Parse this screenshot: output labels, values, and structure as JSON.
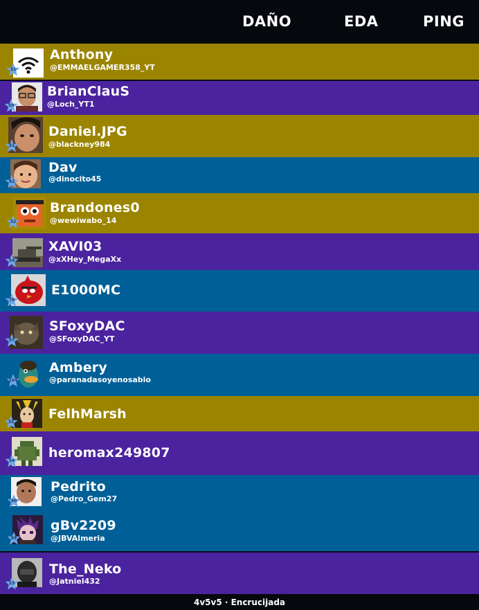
{
  "header": {
    "col_damage": "DAÑO",
    "col_eda": "EDA",
    "col_ping": "PING"
  },
  "players": [
    {
      "name": "Anthony",
      "handle": "@EMMAELGAMER358_YT",
      "level": "31",
      "team": "olive",
      "avatar": "wifi-logo"
    },
    {
      "name": "BrianClauS",
      "handle": "@Loch_YT1",
      "level": "59",
      "team": "purple",
      "avatar": "boy-glasses"
    },
    {
      "name": "Daniel.JPG",
      "handle": "@blackney984",
      "level": "51",
      "team": "olive",
      "avatar": "boy-photo"
    },
    {
      "name": "Dav",
      "handle": "@dinocito45",
      "level": "82",
      "team": "blue",
      "avatar": "child-photo"
    },
    {
      "name": "Brandones0",
      "handle": "@wewiwabo_14",
      "level": "32",
      "team": "olive",
      "avatar": "orange-block-character"
    },
    {
      "name": "XAVI03",
      "handle": "@xXHey_MegaXx",
      "level": "54",
      "team": "purple",
      "avatar": "tank"
    },
    {
      "name": "E1000MC",
      "handle": "",
      "level": "78",
      "team": "blue",
      "avatar": "red-bird"
    },
    {
      "name": "SFoxyDAC",
      "handle": "@SFoxyDAC_YT",
      "level": "97",
      "team": "purple",
      "avatar": "creature"
    },
    {
      "name": "Ambery",
      "handle": "@paranadasoyenosabio",
      "level": "104",
      "team": "blue",
      "avatar": "platypus"
    },
    {
      "name": "FelhMarsh",
      "handle": "",
      "level": "32",
      "team": "olive",
      "avatar": "anime-character"
    },
    {
      "name": "heromax249807",
      "handle": "",
      "level": "54",
      "team": "purple",
      "avatar": "green-robot"
    },
    {
      "name": "Pedrito",
      "handle": "@Pedro_Gem27",
      "level": "90",
      "team": "blue",
      "avatar": "boy-face"
    },
    {
      "name": "gBv2209",
      "handle": "@JBVAlmeria",
      "level": "69",
      "team": "blue",
      "avatar": "purple-pixel-character"
    },
    {
      "name": "The_Neko",
      "handle": "@Jatniel432",
      "level": "23",
      "team": "purple",
      "avatar": "helmet-character"
    }
  ],
  "footer": {
    "mode_label": "4v5v5 · Encrucijada"
  },
  "colors": {
    "olive": "#9b8500",
    "purple": "#4b239f",
    "blue": "#005f96",
    "header_bg": "#05080d",
    "level_star": "#6fa8e6"
  }
}
